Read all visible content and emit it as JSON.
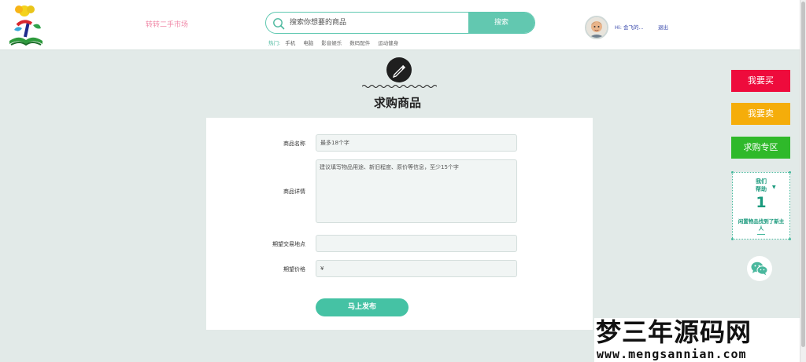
{
  "header": {
    "site_name": "转转二手市场",
    "search": {
      "placeholder": "搜索你想要的商品",
      "button_label": "搜索"
    },
    "hot": {
      "label": "热门:",
      "items": [
        "手机",
        "电脑",
        "影音娱乐",
        "数码配件",
        "运动健身"
      ]
    },
    "user": {
      "greeting": "Hi: 会飞的...",
      "logout_label": "退出"
    }
  },
  "page": {
    "title": "求购商品"
  },
  "form": {
    "name_label": "商品名称",
    "name_placeholder": "最多18个字",
    "detail_label": "商品详情",
    "detail_placeholder": "建议填写物品用途、新旧程度、原价等信息，至少15个字",
    "location_label": "期望交易地点",
    "location_value": "",
    "price_label": "期望价格",
    "price_value": "¥",
    "submit_label": "马上发布"
  },
  "side": {
    "buy_label": "我要买",
    "sell_label": "我要卖",
    "wanted_label": "求购专区",
    "help": {
      "line1": "我们",
      "line2": "帮助",
      "count": "1",
      "desc": "闲置物品找到了新主人"
    },
    "colors": {
      "buy": "#ee0b3c",
      "sell": "#f5ad0a",
      "wanted": "#2fb92a"
    }
  },
  "watermark": {
    "title": "梦三年源码网",
    "url": "www.mengsannian.com"
  }
}
